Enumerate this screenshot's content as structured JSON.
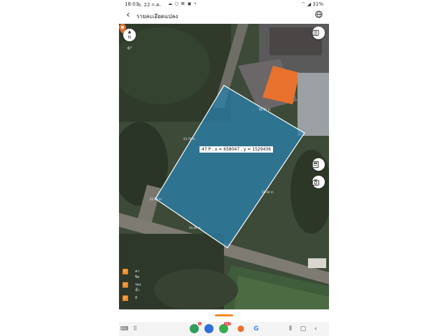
{
  "status_bar": {
    "time": "18:03",
    "date": "จ. 22 ก.ค.",
    "icons": "☁ ◻ ⊠ ▣ •",
    "battery": "31%"
  },
  "header": {
    "title": "รายละเอียดแปลง",
    "back_icon": "back-arrow-icon",
    "globe_icon": "globe-icon"
  },
  "map": {
    "compass_label": "N",
    "degree_label": "6°",
    "marker_label": "47 P , x = 658047 , y = 1529436",
    "edge_labels": [
      "41.31 m",
      "23.79 m",
      "58.44 m",
      "22.99 m",
      "54.49 m"
    ],
    "parcel_fill": "#2a7fa8",
    "roof_color": "#e8722d",
    "pin_color": "#e8722d"
  },
  "legend": [
    {
      "label": "ค่าปิด"
    },
    {
      "label": "ร่องน้ำ"
    },
    {
      "label": "ถี"
    }
  ],
  "accent": "#f08a24",
  "navbar": {
    "badge_1": "1",
    "badge_2": "167"
  }
}
